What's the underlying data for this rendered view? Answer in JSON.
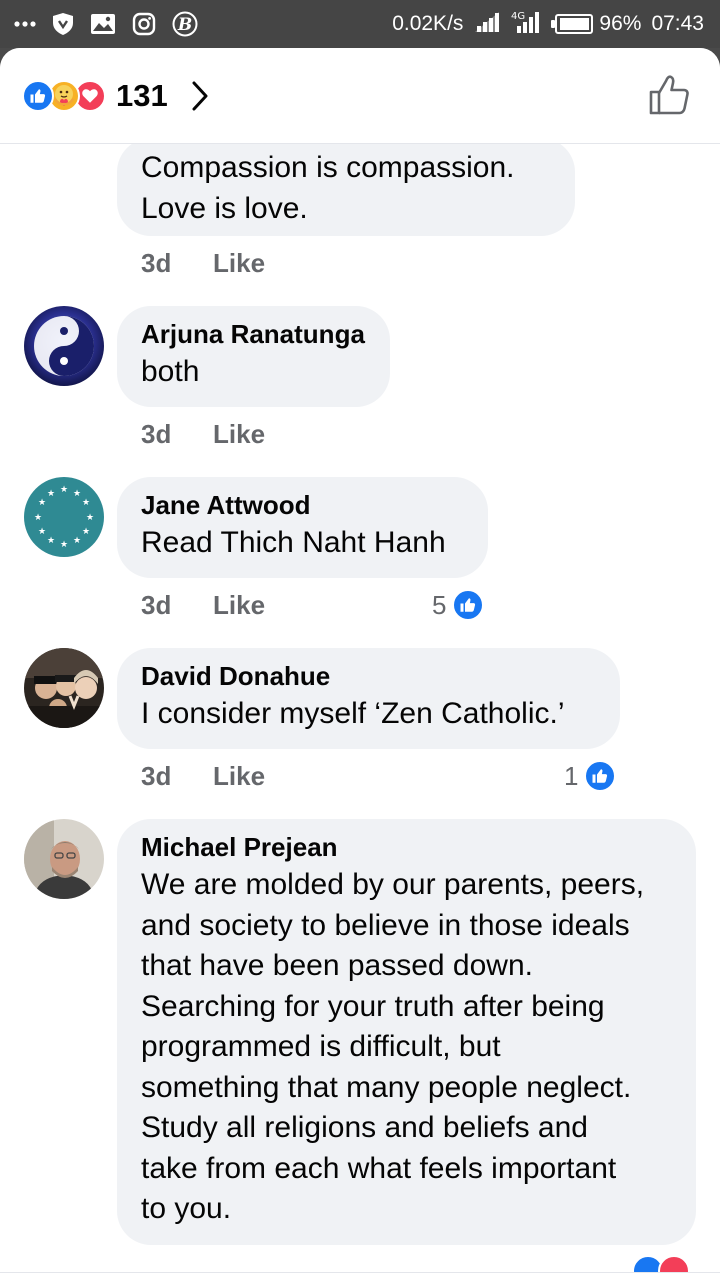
{
  "status_bar": {
    "net_speed": "0.02K/s",
    "battery": "96%",
    "battery_level": 0.96,
    "time": "07:43",
    "icons": [
      "more-dots-icon",
      "shield-icon",
      "gallery-icon",
      "instagram-icon",
      "b-icon",
      "signal-icon",
      "signal-icon",
      "battery-icon"
    ]
  },
  "header": {
    "reaction_icons": [
      "like-icon",
      "care-icon",
      "love-icon"
    ],
    "reaction_count": "131"
  },
  "colors": {
    "facebook_blue": "#1877f2",
    "bubble_bg": "#f0f2f5",
    "meta_gray": "#65676b",
    "care_yellow": "#f7b125",
    "love_red": "#f33e58"
  },
  "comments": [
    {
      "author": "",
      "lines": [
        "Compassion is compassion.",
        "Love is love."
      ],
      "time": "3d",
      "like_label": "Like",
      "reactions": ""
    },
    {
      "author": "Arjuna Ranatunga",
      "lines": [
        "both"
      ],
      "time": "3d",
      "like_label": "Like",
      "reactions": "",
      "avatar": "yin-yang-avatar"
    },
    {
      "author": "Jane Attwood",
      "lines": [
        "Read Thich Naht Hanh"
      ],
      "time": "3d",
      "like_label": "Like",
      "reactions": "5",
      "avatar": "eu-stars-avatar"
    },
    {
      "author": "David Donahue",
      "lines": [
        "I consider myself ‘Zen Catholic.’"
      ],
      "time": "3d",
      "like_label": "Like",
      "reactions": "1",
      "avatar": "group-photo-avatar"
    },
    {
      "author": "Michael Prejean",
      "lines": [
        "We are molded by our parents, peers,",
        "and society to believe in those ideals",
        "that have been passed down.",
        "Searching for your truth after being",
        "programmed is difficult, but",
        "something that many people neglect.",
        "Study all religions and beliefs and",
        "take from each what feels important",
        "to you."
      ],
      "avatar": "man-photo-avatar"
    }
  ]
}
